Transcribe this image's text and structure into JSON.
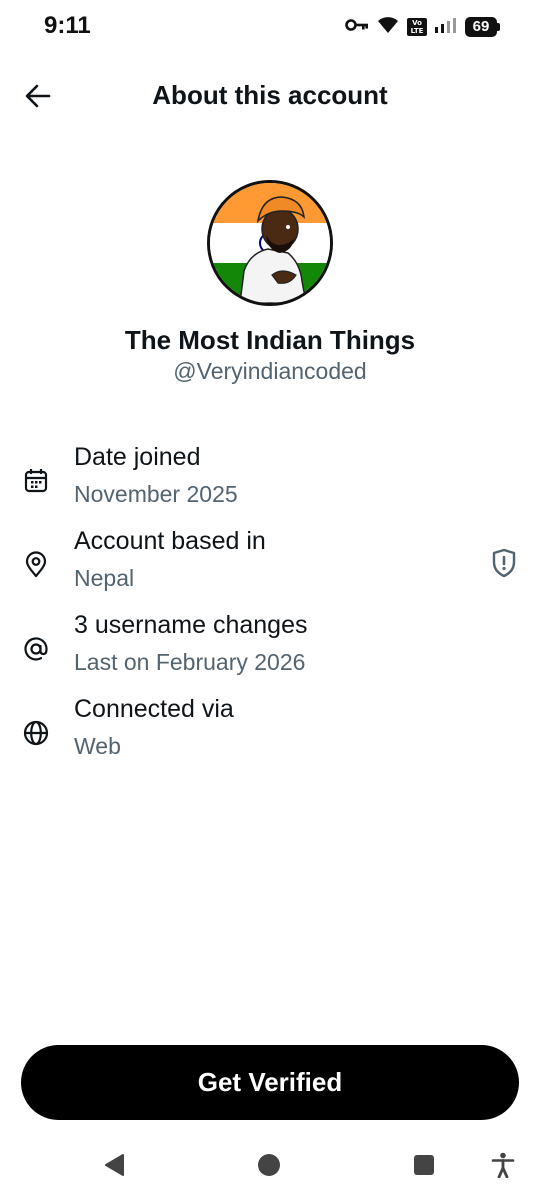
{
  "status_bar": {
    "time": "9:11",
    "network_label_top": "Vo",
    "network_label_bottom": "LTE",
    "battery": "69"
  },
  "header": {
    "title": "About this account"
  },
  "profile": {
    "display_name": "The Most Indian Things",
    "handle": "@Veryindiancoded"
  },
  "details": [
    {
      "title": "Date joined",
      "value": "November 2025",
      "icon": "calendar-icon"
    },
    {
      "title": "Account based in",
      "value": "Nepal",
      "icon": "location-pin-icon"
    },
    {
      "title": "3 username changes",
      "value": "Last on February 2026",
      "icon": "at-sign-icon"
    },
    {
      "title": "Connected via",
      "value": "Web",
      "icon": "globe-icon"
    }
  ],
  "cta": {
    "label": "Get Verified"
  },
  "colors": {
    "primary_text": "#0f1419",
    "secondary_text": "#536471",
    "button_bg": "#000000",
    "saffron": "#FF9933",
    "green": "#138808"
  }
}
